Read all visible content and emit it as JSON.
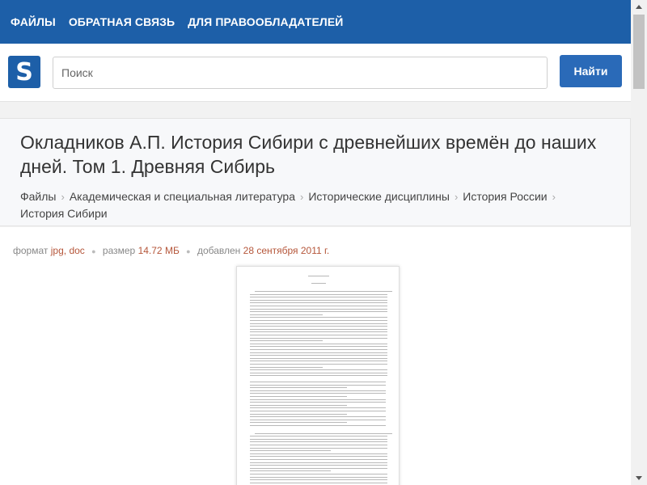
{
  "nav": {
    "files": "ФАЙЛЫ",
    "feedback": "ОБРАТНАЯ СВЯЗЬ",
    "rights": "ДЛЯ ПРАВООБЛАДАТЕЛЕЙ"
  },
  "logo": {
    "letter": "S"
  },
  "search": {
    "placeholder": "Поиск",
    "button": "Найти"
  },
  "doc": {
    "title": "Окладников А.П. История Сибири с древнейших времён до наших дней. Том 1. Древняя Сибирь",
    "breadcrumbs": [
      "Файлы",
      "Академическая и специальная литература",
      "Исторические дисциплины",
      "История России",
      "История Сибири"
    ]
  },
  "meta": {
    "format_label": "формат",
    "format1": "jpg",
    "comma": ",",
    "format2": "doc",
    "size_label": "размер",
    "size": "14.72 МБ",
    "added_label": "добавлен",
    "date": "28 сентября 2011 г."
  },
  "colors": {
    "nav_bg": "#1d5fa8",
    "button": "#2a6ab8",
    "meta_value": "#b5563a"
  }
}
